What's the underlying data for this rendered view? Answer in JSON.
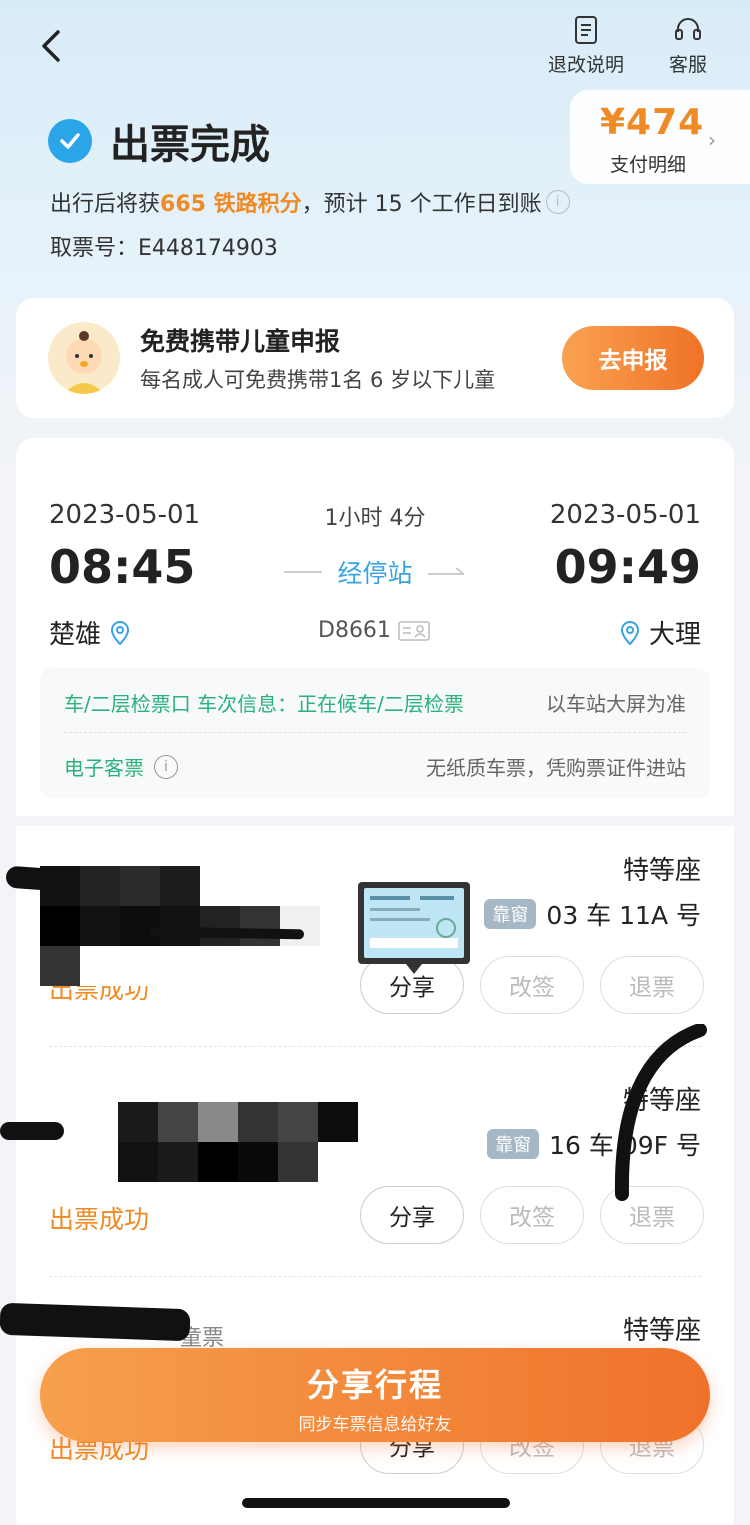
{
  "header": {
    "refund_policy_label": "退改说明",
    "service_label": "客服"
  },
  "price": {
    "amount": "¥474",
    "detail_label": "支付明细"
  },
  "status": {
    "title": "出票完成",
    "points_prefix": "出行后将获",
    "points_highlight": "665 铁路积分",
    "points_suffix": "，预计 15 个工作日到账",
    "ticket_no": "取票号：E448174903"
  },
  "child_declare": {
    "title": "免费携带儿童申报",
    "subtitle": "每名成人可免费携带1名 6 岁以下儿童",
    "button": "去申报"
  },
  "trip": {
    "dep_date": "2023-05-01",
    "arr_date": "2023-05-01",
    "duration": "1小时 4分",
    "dep_time": "08:45",
    "arr_time": "09:49",
    "stops_label": "经停站",
    "dep_station": "楚雄",
    "arr_station": "大理",
    "train_no": "D8661",
    "marquee": "车/二层检票口  车次信息：正在候车/二层检票",
    "marquee_right": "以车站大屏为准",
    "eticket": "电子客票",
    "nopaper": "无纸质车票，凭购票证件进站"
  },
  "passengers": [
    {
      "seat_class": "特等座",
      "window_tag": "靠窗",
      "seat": "03 车 11A 号",
      "status": "出票成功"
    },
    {
      "seat_class": "特等座",
      "window_tag": "靠窗",
      "seat": "16 车 09F 号",
      "status": "出票成功"
    },
    {
      "seat_class": "特等座",
      "ticket_type": "童票",
      "status": "出票成功"
    }
  ],
  "actions": {
    "share": "分享",
    "change": "改签",
    "refund": "退票"
  },
  "share_trip": {
    "title": "分享行程",
    "subtitle": "同步车票信息给好友"
  },
  "colors": {
    "accent_orange": "#f08a24",
    "accent_blue": "#39a3e2",
    "green": "#29b27a"
  }
}
